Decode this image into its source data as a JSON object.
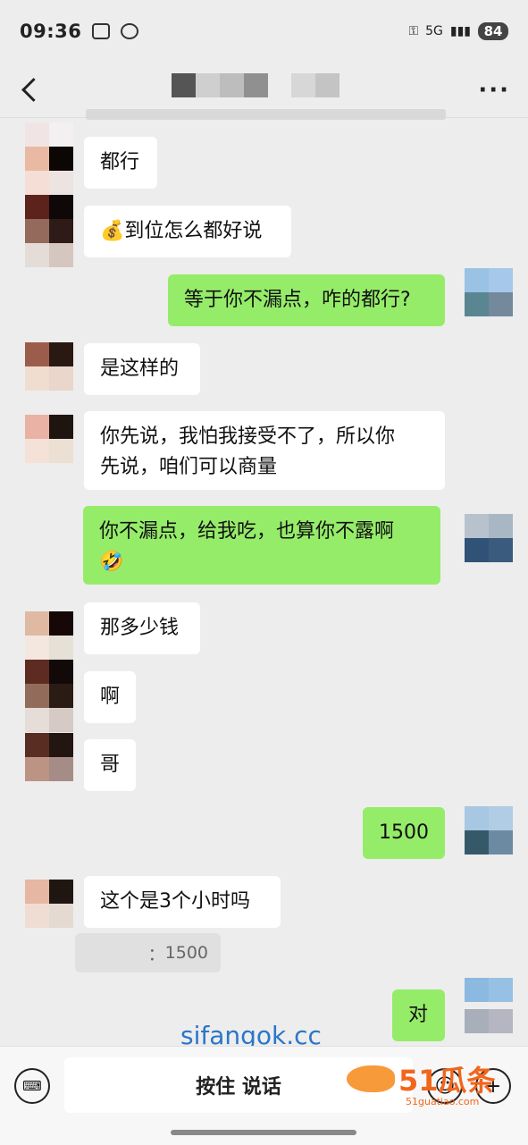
{
  "status": {
    "time": "09:36",
    "network": "5G",
    "battery": "84"
  },
  "chat": {
    "messages": [
      {
        "side": "in",
        "text": "都行"
      },
      {
        "side": "in",
        "text": "💰到位怎么都好说"
      },
      {
        "side": "out",
        "text": "等于你不漏点，咋的都行?"
      },
      {
        "side": "in",
        "text": "是这样的"
      },
      {
        "side": "in",
        "text": "你先说，我怕我接受不了，所以你\n先说，咱们可以商量"
      },
      {
        "side": "out",
        "text": "你不漏点，给我吃，也算你不露啊\n🤣"
      },
      {
        "side": "in",
        "text": "那多少钱"
      },
      {
        "side": "in",
        "text": "啊"
      },
      {
        "side": "in",
        "text": "哥"
      },
      {
        "side": "out",
        "text": "1500"
      },
      {
        "side": "in",
        "text": "这个是3个小时吗"
      },
      {
        "side": "out",
        "text": "对"
      }
    ],
    "quote": "1500"
  },
  "watermark": "sifangok.cc",
  "input": {
    "voice_label": "按住 说话"
  },
  "logo": {
    "text": "51瓜条",
    "sub": "51guatiao.com"
  },
  "colors": {
    "bg": "#ededed",
    "incoming": "#ffffff",
    "outgoing": "#95ec69",
    "accent": "#f2661c"
  },
  "icons": {
    "back": "chevron-left",
    "more": "ellipsis",
    "keyboard": "keyboard-icon",
    "emoji": "emoji-icon",
    "plus": "plus-icon"
  }
}
